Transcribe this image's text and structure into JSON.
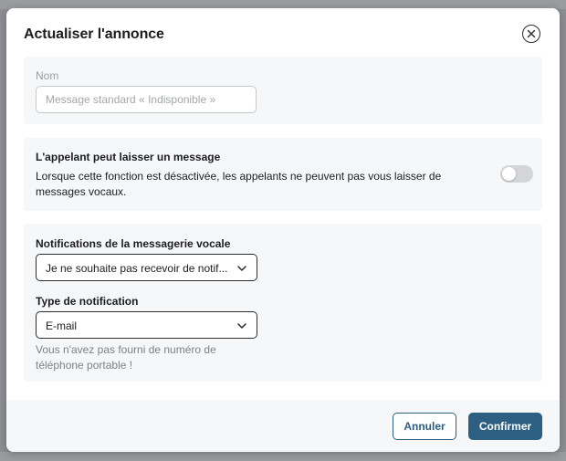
{
  "dialog": {
    "title": "Actualiser l'annonce",
    "close_icon": "close-icon"
  },
  "name_section": {
    "label": "Nom",
    "input_value": "",
    "input_placeholder": "Message standard « Indisponible »"
  },
  "message_section": {
    "title": "L'appelant peut laisser un message",
    "description": "Lorsque cette fonction est désactivée, les appelants ne peuvent pas vous laisser de messages vocaux.",
    "toggle_on": false
  },
  "notifications_section": {
    "voicemail_label": "Notifications de la messagerie vocale",
    "voicemail_value": "Je ne souhaite pas recevoir de notif...",
    "type_label": "Type de notification",
    "type_value": "E-mail",
    "hint": "Vous n'avez pas fourni de numéro de téléphone portable !"
  },
  "footer": {
    "cancel_label": "Annuler",
    "confirm_label": "Confirmer"
  },
  "colors": {
    "primary": "#2d5f82",
    "section_bg": "#f6f7f8",
    "toggle_off": "#d3d5d8"
  }
}
